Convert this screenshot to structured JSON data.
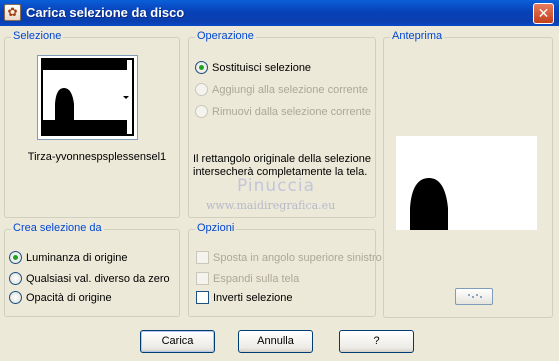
{
  "window": {
    "title": "Carica selezione da disco",
    "close_symbol": "✕",
    "icon": "app-icon"
  },
  "selezione": {
    "title": "Selezione",
    "thumbnail_icon": "selection-thumbnail",
    "file_name": "Tirza-yvonnespsplessensel1"
  },
  "operazione": {
    "title": "Operazione",
    "options": [
      {
        "label": "Sostituisci selezione",
        "checked": true,
        "enabled": true
      },
      {
        "label": "Aggiungi alla selezione corrente",
        "checked": false,
        "enabled": false
      },
      {
        "label": "Rimuovi dalla selezione corrente",
        "checked": false,
        "enabled": false
      }
    ],
    "info_line1": "Il rettangolo originale della selezione",
    "info_line2": "intersecherà completamente la tela."
  },
  "anteprima": {
    "title": "Anteprima"
  },
  "crea": {
    "title": "Crea selezione da",
    "options": [
      {
        "label": "Luminanza di origine",
        "checked": true
      },
      {
        "label": "Qualsiasi val. diverso da zero",
        "checked": false
      },
      {
        "label": "Opacità di origine",
        "checked": false
      }
    ]
  },
  "opzioni": {
    "title": "Opzioni",
    "items": [
      {
        "label": "Sposta in angolo superiore sinistro",
        "checked": false,
        "enabled": false
      },
      {
        "label": "Espandi sulla tela",
        "checked": false,
        "enabled": false
      },
      {
        "label": "Inverti selezione",
        "checked": false,
        "enabled": true
      }
    ]
  },
  "watermark": {
    "name": "Pinuccia",
    "url": "www.maidiregrafica.eu"
  },
  "buttons": {
    "load": "Carica",
    "cancel": "Annulla",
    "help": "?"
  }
}
